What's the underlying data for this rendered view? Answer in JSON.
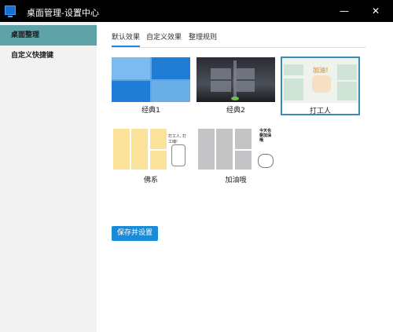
{
  "window": {
    "title": "桌面管理-设置中心",
    "minimize_symbol": "—",
    "close_symbol": "✕"
  },
  "sidebar": {
    "items": [
      {
        "label": "桌面整理",
        "active": true
      },
      {
        "label": "自定义快捷键",
        "active": false
      }
    ]
  },
  "tabs": [
    {
      "label": "默认效果",
      "active": true
    },
    {
      "label": "自定义效果",
      "active": false
    },
    {
      "label": "整理规则",
      "active": false
    }
  ],
  "themes": [
    {
      "label": "经典1",
      "selected": false
    },
    {
      "label": "经典2",
      "selected": false
    },
    {
      "label": "打工人",
      "selected": true,
      "badge_text": "加油!"
    },
    {
      "label": "佛系",
      "selected": false,
      "badge_text": "打工人, 打工魂!"
    },
    {
      "label": "加油哦",
      "selected": false,
      "badge_text": "今天也要加油哦"
    }
  ],
  "actions": {
    "save_label": "保存并设置"
  },
  "colors": {
    "accent": "#1a8bd6",
    "sidebar_active": "#5fa3a8",
    "selected_border": "#3a8ab2"
  }
}
